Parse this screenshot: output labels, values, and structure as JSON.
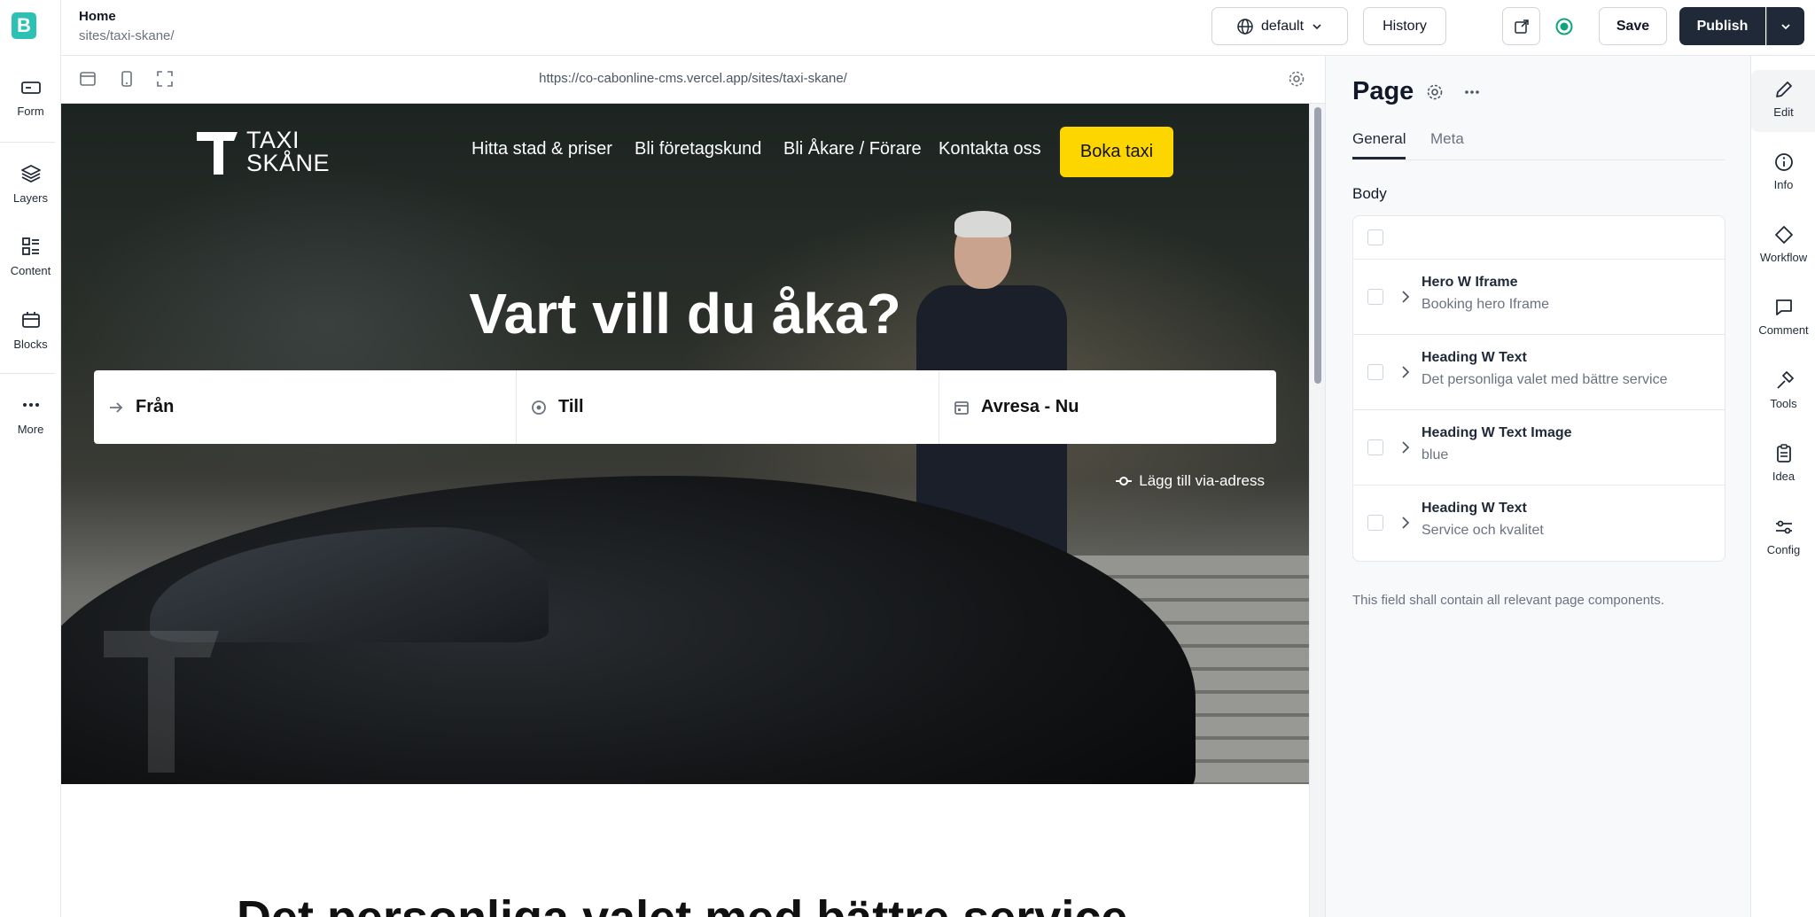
{
  "app": {
    "logo_letter": "B",
    "accent_color": "#2dc1b3"
  },
  "left_rail": {
    "items": [
      {
        "label": "Form",
        "icon": "form-icon"
      },
      {
        "label": "Layers",
        "icon": "layers-icon"
      },
      {
        "label": "Content",
        "icon": "content-icon"
      },
      {
        "label": "Blocks",
        "icon": "blocks-icon"
      },
      {
        "label": "More",
        "icon": "more-icon"
      }
    ]
  },
  "topbar": {
    "title": "Home",
    "path": "sites/taxi-skane/",
    "locale": "default",
    "history_label": "History",
    "save_label": "Save",
    "publish_label": "Publish"
  },
  "preview": {
    "url": "https://co-cabonline-cms.vercel.app/sites/taxi-skane/",
    "site": {
      "logo_line1": "TAXI",
      "logo_line2": "SKÅNE",
      "nav": [
        "Hitta stad & priser",
        "Bli företagskund",
        "Bli Åkare / Förare",
        "Kontakta oss"
      ],
      "cta": "Boka taxi",
      "cta_color": "#fdd600",
      "hero_title": "Vart vill du åka?",
      "search": {
        "from": "Från",
        "to": "Till",
        "when": "Avresa - Nu"
      },
      "via_link": "Lägg till via-adress",
      "section_heading": "Det personliga valet med bättre service"
    }
  },
  "panel": {
    "title": "Page",
    "tabs": [
      "General",
      "Meta"
    ],
    "active_tab": "General",
    "body_label": "Body",
    "rows": [
      {
        "title": "Hero W Iframe",
        "subtitle": "Booking hero Iframe"
      },
      {
        "title": "Heading W Text",
        "subtitle": "Det personliga valet med bättre service"
      },
      {
        "title": "Heading W Text Image",
        "subtitle": "blue"
      },
      {
        "title": "Heading W Text",
        "subtitle": "Service och kvalitet"
      }
    ],
    "help_text": "This field shall contain all relevant page components."
  },
  "right_rail": {
    "items": [
      {
        "label": "Edit",
        "icon": "pencil-icon"
      },
      {
        "label": "Info",
        "icon": "info-icon"
      },
      {
        "label": "Workflow",
        "icon": "workflow-icon"
      },
      {
        "label": "Comment",
        "icon": "comment-icon"
      },
      {
        "label": "Tools",
        "icon": "tools-icon"
      },
      {
        "label": "Idea",
        "icon": "idea-icon"
      },
      {
        "label": "Config",
        "icon": "config-icon"
      }
    ]
  }
}
